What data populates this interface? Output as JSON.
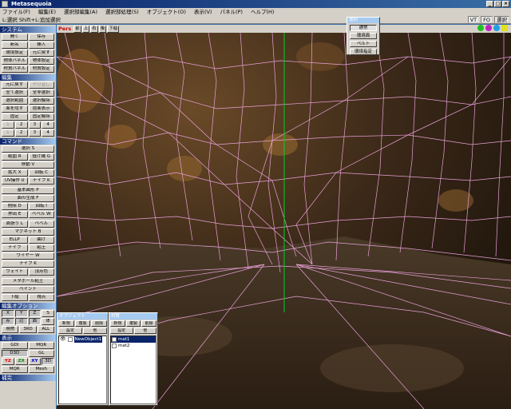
{
  "window": {
    "title": "Metasequoia"
  },
  "menu": [
    "ファイル(F)",
    "編集(E)",
    "選択部編集(A)",
    "選択部処理(S)",
    "オブジェクト(O)",
    "表示(V)",
    "パネル(P)",
    "ヘルプ(H)"
  ],
  "status": {
    "hint": "L:選択 Shift+L:追加選択",
    "vt": "VT",
    "fo": "FO",
    "mode": "選択"
  },
  "left_panel": {
    "system": {
      "header": "システム",
      "rows": [
        [
          "開く",
          "保存"
        ],
        [
          "新名",
          "挿入"
        ],
        [
          "環境設定",
          "元に戻す"
        ],
        [
          "物体パネル",
          "物体設定"
        ],
        [
          "材質パネル",
          "材質設定"
        ]
      ]
    },
    "edit": {
      "header": "編集",
      "rows": [
        [
          "元に戻す",
          "やり直し"
        ],
        [
          "全て選択",
          "全非選択"
        ],
        [
          "選択範囲",
          "選択解除"
        ],
        [
          "面を隠す",
          "隠面表示"
        ],
        [
          "固定",
          "固定解除"
        ],
        [
          "1",
          "2",
          "3",
          "4"
        ],
        [
          "1",
          "2",
          "3",
          "4"
        ]
      ]
    },
    "command": {
      "header": "コマンド",
      "rows": [
        [
          "選択 S"
        ],
        [
          "範囲 R",
          "投げ縄 G"
        ],
        [
          "移動 V"
        ],
        [
          "拡大 X",
          "回転 C"
        ],
        [
          "UV操作 U",
          "ナイフ K"
        ],
        [
          "基本図形 P"
        ],
        [
          "面の生成 F"
        ],
        [
          "削除 D",
          "回転 I"
        ],
        [
          "押出 E",
          "ベベル W"
        ],
        [
          "面張り L",
          "ベベル"
        ],
        [
          "マグネット B"
        ],
        [
          "ELLP",
          "曲げ"
        ],
        [
          "ナイフ",
          "粘土"
        ],
        [
          "ワイヤー W"
        ],
        [
          "ナイフ K"
        ],
        [
          "ウェイト",
          "頂点色"
        ],
        [
          "メタボール粘土"
        ],
        [
          "ペイント"
        ],
        [
          "下絵",
          "視点"
        ]
      ]
    },
    "editopt": {
      "header": "編集オプション",
      "rows": [
        [
          "X",
          "Y",
          "Z",
          "S"
        ],
        [
          "点",
          "辺",
          "面",
          "体"
        ],
        [
          "現物",
          "3RD",
          "ALL"
        ]
      ]
    },
    "display": {
      "header": "表示",
      "rows": [
        [
          "GDI",
          "MQR"
        ],
        [
          "D3D",
          "GL"
        ],
        [
          "YZ",
          "ZX",
          "XY",
          "3D"
        ],
        [
          "MQR",
          "Mesh"
        ]
      ]
    },
    "other": {
      "header": "補完"
    }
  },
  "viewport": {
    "label": "Pers",
    "tabs": [
      "前",
      "上",
      "右",
      "後",
      "下絵"
    ]
  },
  "popup": {
    "title": "選択",
    "items": [
      "通常",
      "環境面",
      "ペルト",
      "環境指定"
    ]
  },
  "object_panel": {
    "title": "オブジェクト",
    "buttons": [
      [
        "新規",
        "複製",
        "削除"
      ],
      [
        "設定",
        "他"
      ]
    ],
    "items": [
      {
        "name": "NewObject1",
        "selected": true
      }
    ]
  },
  "material_panel": {
    "title": "材質",
    "buttons": [
      [
        "新規",
        "複製",
        "削除"
      ],
      [
        "設定",
        "他"
      ]
    ],
    "items": [
      {
        "name": "mat1",
        "selected": true
      },
      {
        "name": "mat2",
        "selected": false
      }
    ]
  },
  "colors": {
    "title_start": "#0a246a",
    "title_end": "#3a6ea5",
    "wire": "#e8a0d8",
    "axis": "#00d020",
    "select": "#0a246a"
  }
}
